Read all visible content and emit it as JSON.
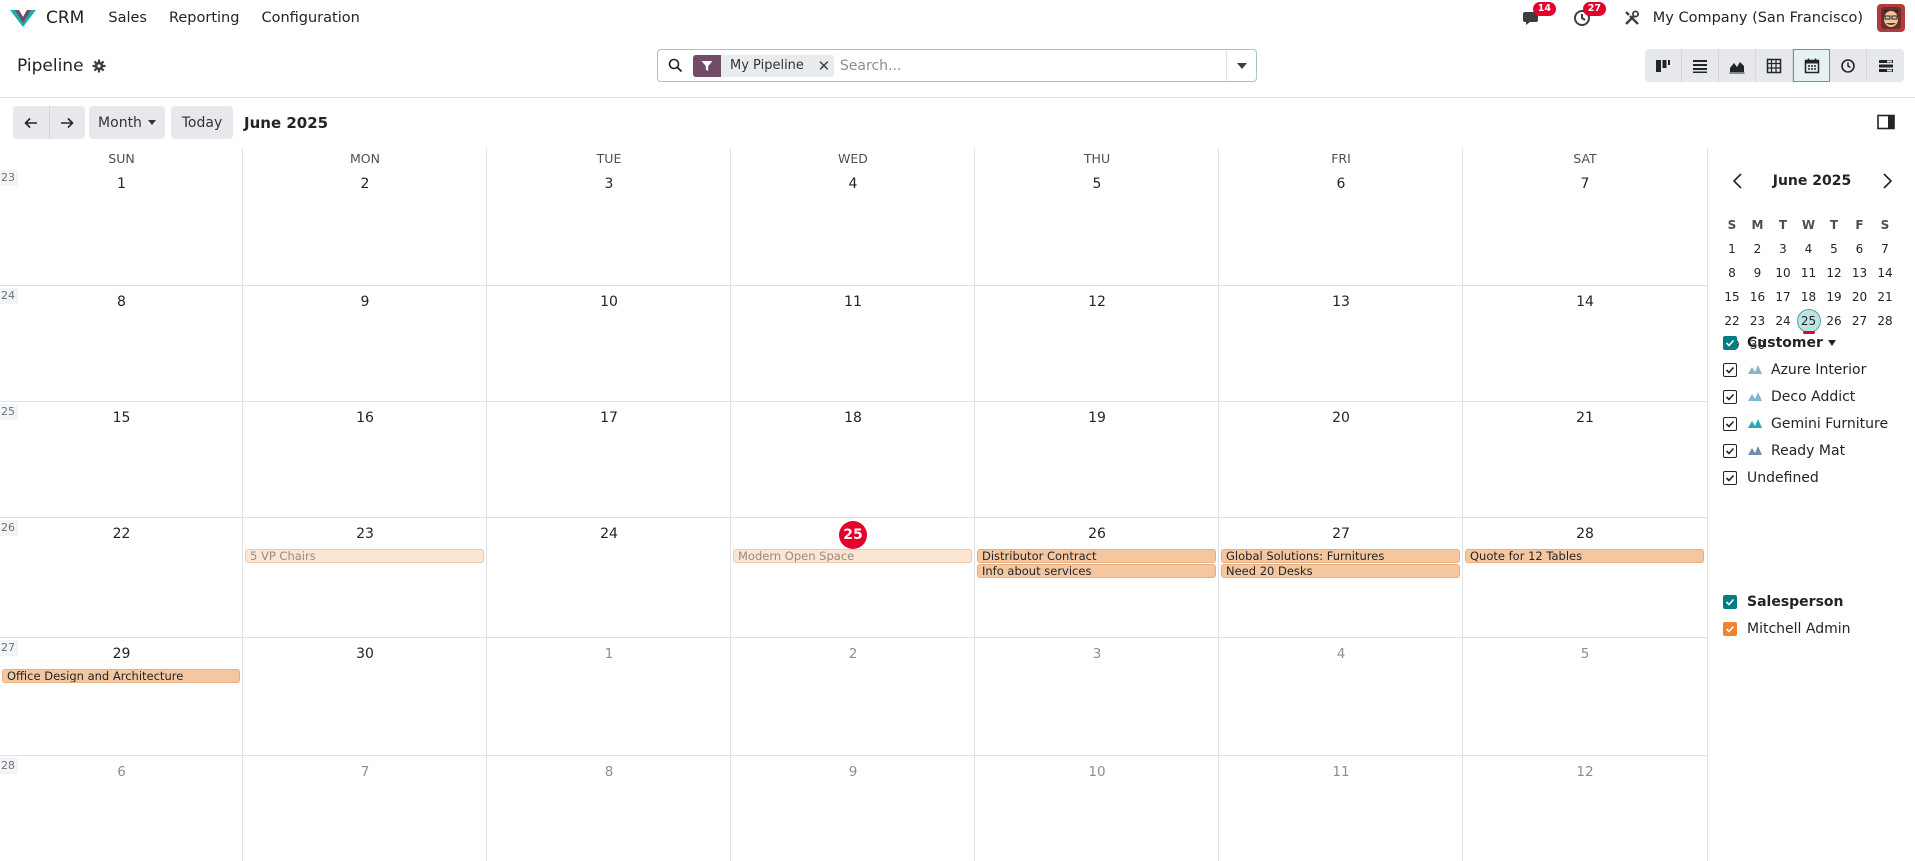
{
  "app": {
    "brand": "CRM",
    "menu": [
      "Sales",
      "Reporting",
      "Configuration"
    ],
    "messages_badge": "14",
    "activities_badge": "27",
    "company": "My Company (San Francisco)"
  },
  "control": {
    "title": "Pipeline",
    "facet_label": "My Pipeline",
    "search_placeholder": "Search..."
  },
  "toolbar": {
    "scale_label": "Month",
    "today_label": "Today",
    "period": "June 2025"
  },
  "calendar": {
    "weekdays": [
      "SUN",
      "MON",
      "TUE",
      "WED",
      "THU",
      "FRI",
      "SAT"
    ],
    "week_numbers": [
      "23",
      "24",
      "25",
      "26",
      "27",
      "28"
    ],
    "weeks": [
      [
        "1",
        "2",
        "3",
        "4",
        "5",
        "6",
        "7"
      ],
      [
        "8",
        "9",
        "10",
        "11",
        "12",
        "13",
        "14"
      ],
      [
        "15",
        "16",
        "17",
        "18",
        "19",
        "20",
        "21"
      ],
      [
        "22",
        "23",
        "24",
        "25",
        "26",
        "27",
        "28"
      ],
      [
        "29",
        "30",
        "1",
        "2",
        "3",
        "4",
        "5"
      ],
      [
        "6",
        "7",
        "8",
        "9",
        "10",
        "11",
        "12"
      ]
    ],
    "today": "25",
    "events": [
      {
        "title": "5 VP Chairs",
        "week": 3,
        "day": 1,
        "row": 0,
        "style": "faded"
      },
      {
        "title": "Modern Open Space",
        "week": 3,
        "day": 3,
        "row": 0,
        "style": "faded"
      },
      {
        "title": "Distributor Contract",
        "week": 3,
        "day": 4,
        "row": 0,
        "style": "solid"
      },
      {
        "title": "Info about services",
        "week": 3,
        "day": 4,
        "row": 1,
        "style": "solid"
      },
      {
        "title": "Global Solutions: Furnitures",
        "week": 3,
        "day": 5,
        "row": 0,
        "style": "solid"
      },
      {
        "title": "Need 20 Desks",
        "week": 3,
        "day": 5,
        "row": 1,
        "style": "solid"
      },
      {
        "title": "Quote for 12 Tables",
        "week": 3,
        "day": 6,
        "row": 0,
        "style": "solid"
      },
      {
        "title": "Office Design and Architecture",
        "week": 4,
        "day": 0,
        "row": 0,
        "style": "solid"
      }
    ]
  },
  "sidebar": {
    "mini_title": "June 2025",
    "mini_weekdays": [
      "S",
      "M",
      "T",
      "W",
      "T",
      "F",
      "S"
    ],
    "mini_weeks": [
      [
        "1",
        "2",
        "3",
        "4",
        "5",
        "6",
        "7"
      ],
      [
        "8",
        "9",
        "10",
        "11",
        "12",
        "13",
        "14"
      ],
      [
        "15",
        "16",
        "17",
        "18",
        "19",
        "20",
        "21"
      ],
      [
        "22",
        "23",
        "24",
        "25",
        "26",
        "27",
        "28"
      ],
      [
        "29",
        "30",
        "",
        "",
        "",
        "",
        ""
      ]
    ],
    "customer_label": "Customer",
    "customers": [
      "Azure Interior",
      "Deco Addict",
      "Gemini Furniture",
      "Ready Mat",
      "Undefined"
    ],
    "salesperson_label": "Salesperson",
    "salespersons": [
      "Mitchell Admin"
    ]
  },
  "colors": {
    "accent_teal": "#017e84",
    "brand_purple": "#714b67",
    "today_red": "#e4002b",
    "event_orange": "#f5c7a1",
    "salesperson_orange": "#f0832d"
  }
}
